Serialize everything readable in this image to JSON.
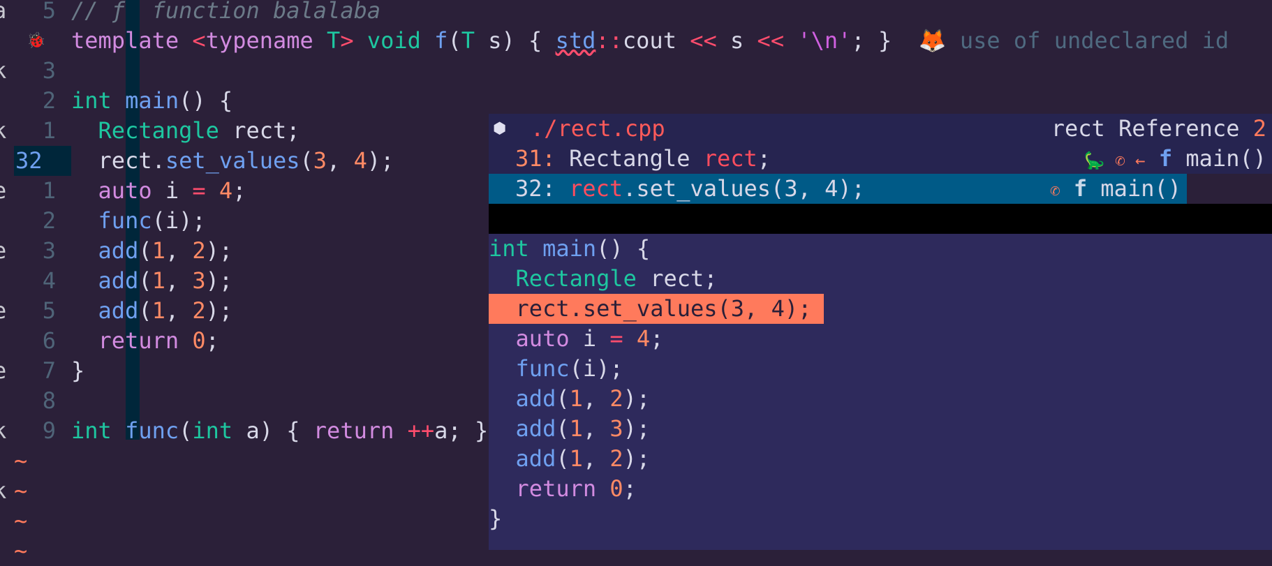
{
  "colors": {
    "background": "#2b2039",
    "popup": "#2e2a5c",
    "selection": "#005a87",
    "highlight": "#ff7a5c"
  },
  "editor": {
    "gutter_cut": [
      "a",
      "",
      "k",
      "",
      "k",
      "",
      "e",
      "",
      "e",
      "",
      "e",
      "",
      "e",
      "",
      "k",
      "",
      "k",
      ""
    ],
    "lines": [
      {
        "num": "5",
        "tokens": [
          {
            "t": "// ƒ  function balalaba",
            "c": "cm"
          }
        ]
      },
      {
        "num": "",
        "icon": "bug-icon",
        "tokens": [
          {
            "t": "template ",
            "c": "kw"
          },
          {
            "t": "<",
            "c": "op"
          },
          {
            "t": "typename ",
            "c": "kw"
          },
          {
            "t": "T",
            "c": "ty"
          },
          {
            "t": "> ",
            "c": "op"
          },
          {
            "t": "void ",
            "c": "ty"
          },
          {
            "t": "f",
            "c": "fn"
          },
          {
            "t": "(",
            "c": "pl"
          },
          {
            "t": "T",
            "c": "ty"
          },
          {
            "t": " s) { ",
            "c": "pl"
          },
          {
            "t": "std",
            "c": "fn er"
          },
          {
            "t": "::",
            "c": "op"
          },
          {
            "t": "cout ",
            "c": "pl"
          },
          {
            "t": "<<",
            "c": "op"
          },
          {
            "t": " s ",
            "c": "pl"
          },
          {
            "t": "<<",
            "c": "op"
          },
          {
            "t": " ",
            "c": "pl"
          },
          {
            "t": "'\\n'",
            "c": "st"
          },
          {
            "t": "; }  ",
            "c": "pl"
          },
          {
            "t": "🦊 ",
            "c": "pl"
          },
          {
            "t": "use of undeclared id",
            "c": "diag"
          }
        ]
      },
      {
        "num": "3",
        "tokens": []
      },
      {
        "num": "2",
        "tokens": [
          {
            "t": "int ",
            "c": "ty"
          },
          {
            "t": "main",
            "c": "fn"
          },
          {
            "t": "() {",
            "c": "pl"
          }
        ]
      },
      {
        "num": "1",
        "tokens": [
          {
            "t": "  Rectangle ",
            "c": "ty"
          },
          {
            "t": "rect;",
            "c": "pl"
          }
        ]
      },
      {
        "num": "32",
        "current": true,
        "tokens": [
          {
            "t": "  rect.",
            "c": "pl"
          },
          {
            "t": "set_values",
            "c": "fn"
          },
          {
            "t": "(",
            "c": "pl"
          },
          {
            "t": "3",
            "c": "nm"
          },
          {
            "t": ", ",
            "c": "pl"
          },
          {
            "t": "4",
            "c": "nm"
          },
          {
            "t": ");",
            "c": "pl"
          }
        ]
      },
      {
        "num": "1",
        "tokens": [
          {
            "t": "  auto ",
            "c": "kw"
          },
          {
            "t": "i ",
            "c": "pl"
          },
          {
            "t": "=",
            "c": "op"
          },
          {
            "t": " ",
            "c": "pl"
          },
          {
            "t": "4",
            "c": "nm"
          },
          {
            "t": ";",
            "c": "pl"
          }
        ]
      },
      {
        "num": "2",
        "tokens": [
          {
            "t": "  func",
            "c": "fn"
          },
          {
            "t": "(i);",
            "c": "pl"
          }
        ]
      },
      {
        "num": "3",
        "tokens": [
          {
            "t": "  add",
            "c": "fn"
          },
          {
            "t": "(",
            "c": "pl"
          },
          {
            "t": "1",
            "c": "nm"
          },
          {
            "t": ", ",
            "c": "pl"
          },
          {
            "t": "2",
            "c": "nm"
          },
          {
            "t": ");",
            "c": "pl"
          }
        ]
      },
      {
        "num": "4",
        "tokens": [
          {
            "t": "  add",
            "c": "fn"
          },
          {
            "t": "(",
            "c": "pl"
          },
          {
            "t": "1",
            "c": "nm"
          },
          {
            "t": ", ",
            "c": "pl"
          },
          {
            "t": "3",
            "c": "nm"
          },
          {
            "t": ");",
            "c": "pl"
          }
        ]
      },
      {
        "num": "5",
        "tokens": [
          {
            "t": "  add",
            "c": "fn"
          },
          {
            "t": "(",
            "c": "pl"
          },
          {
            "t": "1",
            "c": "nm"
          },
          {
            "t": ", ",
            "c": "pl"
          },
          {
            "t": "2",
            "c": "nm"
          },
          {
            "t": ");",
            "c": "pl"
          }
        ]
      },
      {
        "num": "6",
        "tokens": [
          {
            "t": "  return ",
            "c": "kw"
          },
          {
            "t": "0",
            "c": "nm"
          },
          {
            "t": ";",
            "c": "pl"
          }
        ]
      },
      {
        "num": "7",
        "tokens": [
          {
            "t": "}",
            "c": "pl"
          }
        ]
      },
      {
        "num": "8",
        "tokens": []
      },
      {
        "num": "9",
        "tokens": [
          {
            "t": "int ",
            "c": "ty"
          },
          {
            "t": "func",
            "c": "fn"
          },
          {
            "t": "(",
            "c": "pl"
          },
          {
            "t": "int ",
            "c": "ty"
          },
          {
            "t": "a) { ",
            "c": "pl"
          },
          {
            "t": "return ",
            "c": "kw"
          },
          {
            "t": "++",
            "c": "op"
          },
          {
            "t": "a; }",
            "c": "pl"
          }
        ]
      }
    ],
    "tilde": "~"
  },
  "popup": {
    "file_icon": "cpp-file-icon",
    "file": "./rect.cpp",
    "title_word": "rect",
    "title_label": "Reference",
    "count": "2",
    "refs": [
      {
        "line": "31:",
        "tokens": [
          {
            "t": " Rectangle ",
            "c": "pl"
          },
          {
            "t": "rect",
            "c": "rf"
          },
          {
            "t": ";",
            "c": "pl"
          }
        ],
        "icons": "🦕 ✆ ←",
        "kind": "f",
        "scope": "main()"
      },
      {
        "line": "32:",
        "tokens": [
          {
            "t": " ",
            "c": "pl"
          },
          {
            "t": "rect",
            "c": "rf"
          },
          {
            "t": ".set_values(3, 4);",
            "c": "pl"
          }
        ],
        "icons": "✆",
        "kind": "f",
        "scope": "main()"
      }
    ],
    "preview": [
      {
        "tokens": [
          {
            "t": "int ",
            "c": "ty"
          },
          {
            "t": "main",
            "c": "fn"
          },
          {
            "t": "() {",
            "c": "pl"
          }
        ]
      },
      {
        "tokens": [
          {
            "t": "  Rectangle ",
            "c": "ty"
          },
          {
            "t": "rect;",
            "c": "pl"
          }
        ]
      },
      {
        "hl": true,
        "tokens": [
          {
            "t": "  rect.set_values(3, 4);",
            "c": "pl"
          }
        ]
      },
      {
        "tokens": [
          {
            "t": "  auto ",
            "c": "kw"
          },
          {
            "t": "i ",
            "c": "pl"
          },
          {
            "t": "=",
            "c": "op"
          },
          {
            "t": " ",
            "c": "pl"
          },
          {
            "t": "4",
            "c": "nm"
          },
          {
            "t": ";",
            "c": "pl"
          }
        ]
      },
      {
        "tokens": [
          {
            "t": "  func",
            "c": "fn"
          },
          {
            "t": "(i);",
            "c": "pl"
          }
        ]
      },
      {
        "tokens": [
          {
            "t": "  add",
            "c": "fn"
          },
          {
            "t": "(",
            "c": "pl"
          },
          {
            "t": "1",
            "c": "nm"
          },
          {
            "t": ", ",
            "c": "pl"
          },
          {
            "t": "2",
            "c": "nm"
          },
          {
            "t": ");",
            "c": "pl"
          }
        ]
      },
      {
        "tokens": [
          {
            "t": "  add",
            "c": "fn"
          },
          {
            "t": "(",
            "c": "pl"
          },
          {
            "t": "1",
            "c": "nm"
          },
          {
            "t": ", ",
            "c": "pl"
          },
          {
            "t": "3",
            "c": "nm"
          },
          {
            "t": ");",
            "c": "pl"
          }
        ]
      },
      {
        "tokens": [
          {
            "t": "  add",
            "c": "fn"
          },
          {
            "t": "(",
            "c": "pl"
          },
          {
            "t": "1",
            "c": "nm"
          },
          {
            "t": ", ",
            "c": "pl"
          },
          {
            "t": "2",
            "c": "nm"
          },
          {
            "t": ");",
            "c": "pl"
          }
        ]
      },
      {
        "tokens": [
          {
            "t": "  return ",
            "c": "kw"
          },
          {
            "t": "0",
            "c": "nm"
          },
          {
            "t": ";",
            "c": "pl"
          }
        ]
      },
      {
        "tokens": [
          {
            "t": "}",
            "c": "pl"
          }
        ]
      }
    ]
  }
}
